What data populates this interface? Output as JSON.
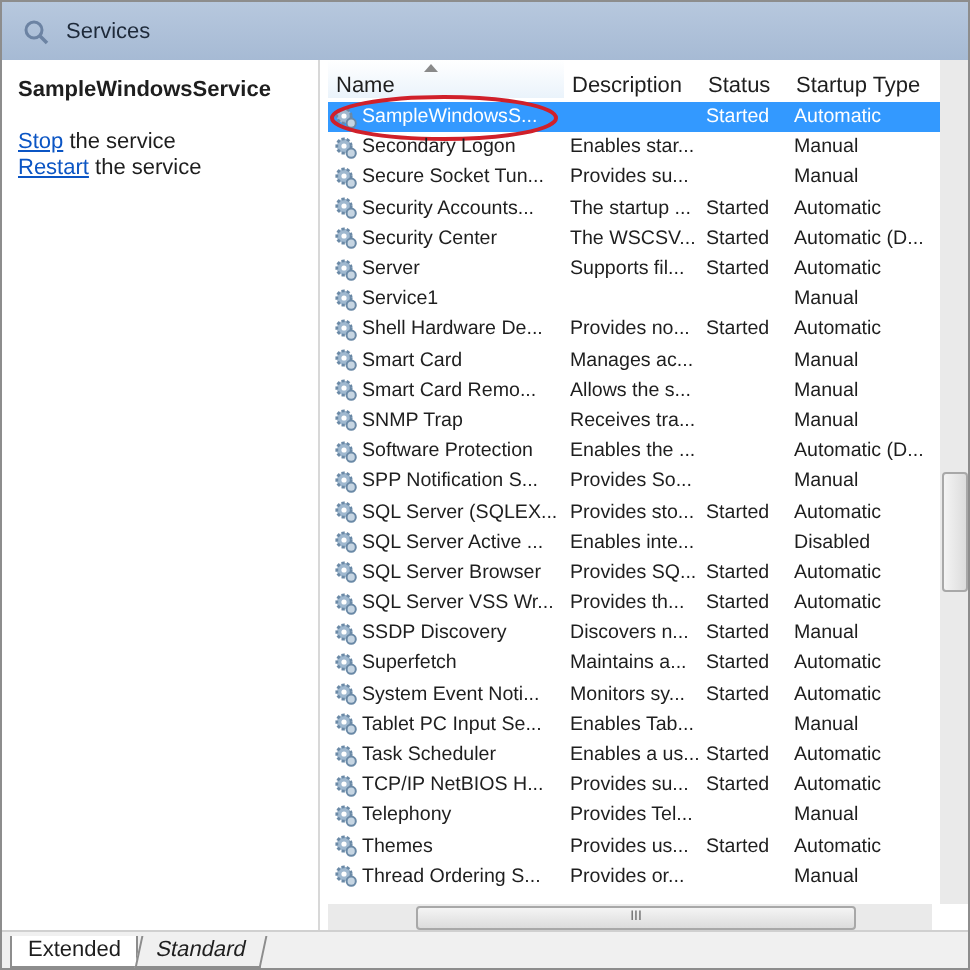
{
  "window": {
    "title": "Services"
  },
  "details": {
    "service_name": "SampleWindowsService",
    "actions": [
      {
        "link": "Stop",
        "text": " the service"
      },
      {
        "link": "Restart",
        "text": " the service"
      }
    ]
  },
  "table": {
    "columns": [
      {
        "label": "Name",
        "sorted": true
      },
      {
        "label": "Description",
        "sorted": false
      },
      {
        "label": "Status",
        "sorted": false
      },
      {
        "label": "Startup Type",
        "sorted": false
      }
    ],
    "rows": [
      {
        "name": "SampleWindowsS...",
        "description": "",
        "status": "Started",
        "startup": "Automatic",
        "selected": true,
        "circled": true
      },
      {
        "name": "Secondary Logon",
        "description": "Enables star...",
        "status": "",
        "startup": "Manual",
        "selected": false,
        "circled": false
      },
      {
        "name": "Secure Socket Tun...",
        "description": "Provides su...",
        "status": "",
        "startup": "Manual",
        "selected": false,
        "circled": false
      },
      {
        "name": "Security Accounts...",
        "description": "The startup ...",
        "status": "Started",
        "startup": "Automatic",
        "selected": false,
        "circled": false
      },
      {
        "name": "Security Center",
        "description": "The WSCSV...",
        "status": "Started",
        "startup": "Automatic (D...",
        "selected": false,
        "circled": false
      },
      {
        "name": "Server",
        "description": "Supports fil...",
        "status": "Started",
        "startup": "Automatic",
        "selected": false,
        "circled": false
      },
      {
        "name": "Service1",
        "description": "",
        "status": "",
        "startup": "Manual",
        "selected": false,
        "circled": false
      },
      {
        "name": "Shell Hardware De...",
        "description": "Provides no...",
        "status": "Started",
        "startup": "Automatic",
        "selected": false,
        "circled": false
      },
      {
        "name": "Smart Card",
        "description": "Manages ac...",
        "status": "",
        "startup": "Manual",
        "selected": false,
        "circled": false
      },
      {
        "name": "Smart Card Remo...",
        "description": "Allows the s...",
        "status": "",
        "startup": "Manual",
        "selected": false,
        "circled": false
      },
      {
        "name": "SNMP Trap",
        "description": "Receives tra...",
        "status": "",
        "startup": "Manual",
        "selected": false,
        "circled": false
      },
      {
        "name": "Software Protection",
        "description": "Enables the ...",
        "status": "",
        "startup": "Automatic (D...",
        "selected": false,
        "circled": false
      },
      {
        "name": "SPP Notification S...",
        "description": "Provides So...",
        "status": "",
        "startup": "Manual",
        "selected": false,
        "circled": false
      },
      {
        "name": "SQL Server (SQLEX...",
        "description": "Provides sto...",
        "status": "Started",
        "startup": "Automatic",
        "selected": false,
        "circled": false
      },
      {
        "name": "SQL Server Active ...",
        "description": "Enables inte...",
        "status": "",
        "startup": "Disabled",
        "selected": false,
        "circled": false
      },
      {
        "name": "SQL Server Browser",
        "description": "Provides SQ...",
        "status": "Started",
        "startup": "Automatic",
        "selected": false,
        "circled": false
      },
      {
        "name": "SQL Server VSS Wr...",
        "description": "Provides th...",
        "status": "Started",
        "startup": "Automatic",
        "selected": false,
        "circled": false
      },
      {
        "name": "SSDP Discovery",
        "description": "Discovers n...",
        "status": "Started",
        "startup": "Manual",
        "selected": false,
        "circled": false
      },
      {
        "name": "Superfetch",
        "description": "Maintains a...",
        "status": "Started",
        "startup": "Automatic",
        "selected": false,
        "circled": false
      },
      {
        "name": "System Event Noti...",
        "description": "Monitors sy...",
        "status": "Started",
        "startup": "Automatic",
        "selected": false,
        "circled": false
      },
      {
        "name": "Tablet PC Input Se...",
        "description": "Enables Tab...",
        "status": "",
        "startup": "Manual",
        "selected": false,
        "circled": false
      },
      {
        "name": "Task Scheduler",
        "description": "Enables a us...",
        "status": "Started",
        "startup": "Automatic",
        "selected": false,
        "circled": false
      },
      {
        "name": "TCP/IP NetBIOS H...",
        "description": "Provides su...",
        "status": "Started",
        "startup": "Automatic",
        "selected": false,
        "circled": false
      },
      {
        "name": "Telephony",
        "description": "Provides Tel...",
        "status": "",
        "startup": "Manual",
        "selected": false,
        "circled": false
      },
      {
        "name": "Themes",
        "description": "Provides us...",
        "status": "Started",
        "startup": "Automatic",
        "selected": false,
        "circled": false
      },
      {
        "name": "Thread Ordering S...",
        "description": "Provides or...",
        "status": "",
        "startup": "Manual",
        "selected": false,
        "circled": false
      }
    ]
  },
  "horizontal_scrollbar": {
    "thumb_grip": "III"
  },
  "tabs": [
    {
      "label": "Extended",
      "selected": true
    },
    {
      "label": "Standard",
      "selected": false
    }
  ]
}
